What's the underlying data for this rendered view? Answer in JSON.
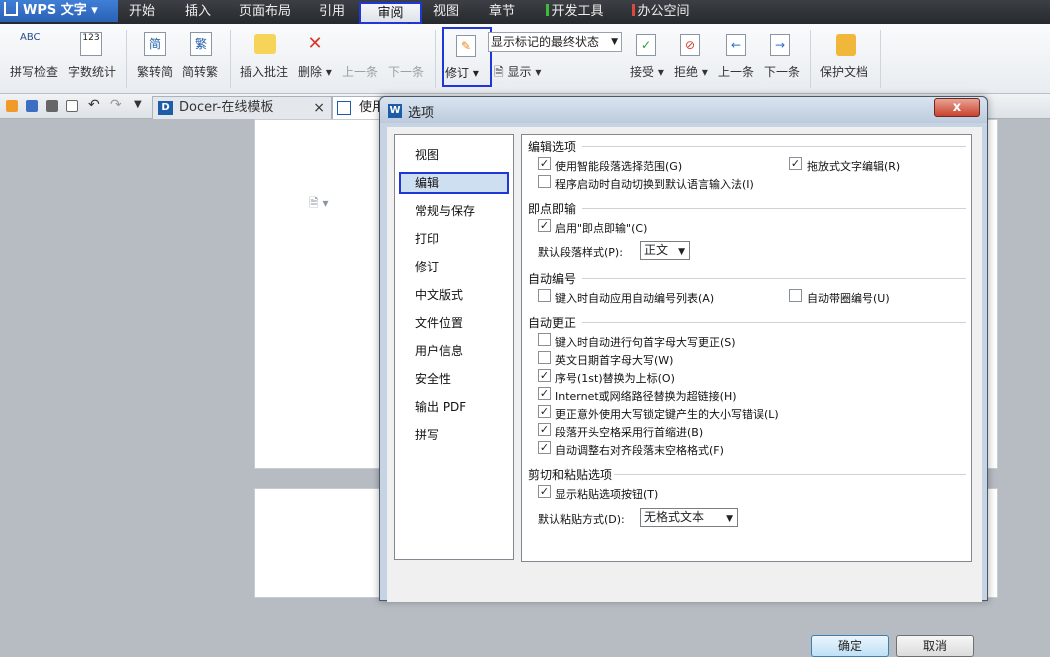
{
  "menubar": {
    "app": "WPS 文字",
    "tabs": [
      "开始",
      "插入",
      "页面布局",
      "引用",
      "审阅",
      "视图",
      "章节",
      "开发工具",
      "办公空间"
    ],
    "active": "审阅"
  },
  "ribbon": {
    "spell": "拼写检查",
    "abc": "ABC",
    "wordcount": "字数统计",
    "num": "123",
    "to_simp": "繁转简",
    "to_trad": "简转繁",
    "simp_char": "简",
    "trad_char": "繁",
    "insert_comment": "插入批注",
    "delete": "删除",
    "prev": "上一条",
    "next": "下一条",
    "track": "修订",
    "display_mode": "显示标记的最终状态",
    "show": "显示",
    "accept": "接受",
    "reject": "拒绝",
    "prev2": "上一条",
    "next2": "下一条",
    "protect": "保护文档"
  },
  "docbar": {
    "tab1": "Docer-在线模板",
    "tab1_close": "×",
    "tab2": "使用"
  },
  "dialog": {
    "title": "选项",
    "close": "x",
    "categories": [
      "视图",
      "编辑",
      "常规与保存",
      "打印",
      "修订",
      "中文版式",
      "文件位置",
      "用户信息",
      "安全性",
      "输出 PDF",
      "拼写"
    ],
    "selected": "编辑",
    "sections": {
      "edit": "编辑选项",
      "click": "即点即输",
      "autonum": "自动编号",
      "autocorrect": "自动更正",
      "paste": "剪切和粘贴选项"
    },
    "options": {
      "smart_para": "使用智能段落选择范围(G)",
      "drag_drop": "拖放式文字编辑(R)",
      "ime": "程序启动时自动切换到默认语言输入法(I)",
      "click_type": "启用\"即点即输\"(C)",
      "default_para_label": "默认段落样式(P):",
      "default_para_value": "正文",
      "auto_list": "键入时自动应用自动编号列表(A)",
      "circled_num": "自动带圈编号(U)",
      "cap_first": "键入时自动进行句首字母大写更正(S)",
      "cap_date": "英文日期首字母大写(W)",
      "ordinal": "序号(1st)替换为上标(O)",
      "hyperlink": "Internet或网络路径替换为超链接(H)",
      "capslock": "更正意外使用大写锁定键产生的大小写错误(L)",
      "indent": "段落开头空格采用行首缩进(B)",
      "right_align": "自动调整右对齐段落末空格格式(F)",
      "paste_btn": "显示粘贴选项按钮(T)",
      "paste_mode_label": "默认粘贴方式(D):",
      "paste_mode_value": "无格式文本"
    },
    "checked": {
      "smart_para": true,
      "drag_drop": true,
      "ime": false,
      "click_type": true,
      "auto_list": false,
      "circled_num": false,
      "cap_first": false,
      "cap_date": false,
      "ordinal": true,
      "hyperlink": true,
      "capslock": true,
      "indent": true,
      "right_align": true,
      "paste_btn": true
    },
    "ok": "确定",
    "cancel": "取消"
  },
  "colors": {
    "accent": "#1f36d8",
    "dev_tag": "#3bbd3b",
    "office_tag": "#e0463c"
  }
}
